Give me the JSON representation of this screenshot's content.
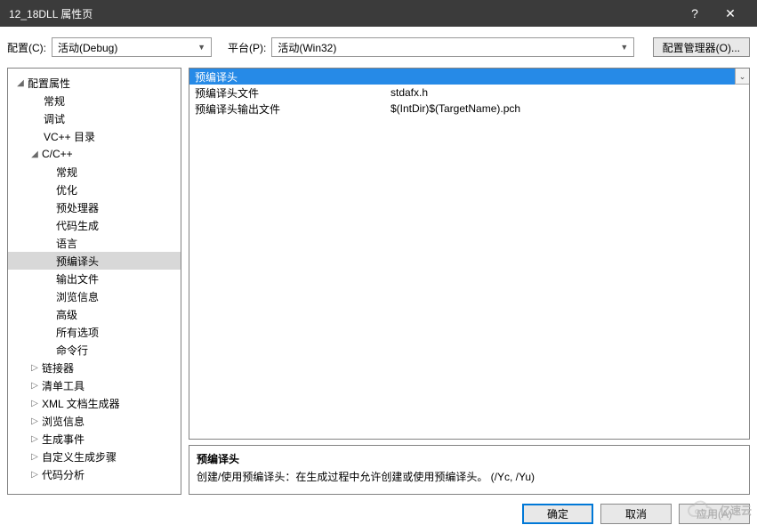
{
  "title": "12_18DLL 属性页",
  "help_glyph": "?",
  "close_glyph": "✕",
  "toolbar": {
    "config_label": "配置(C):",
    "config_value": "活动(Debug)",
    "platform_label": "平台(P):",
    "platform_value": "活动(Win32)",
    "manager_label": "配置管理器(O)..."
  },
  "tree": {
    "root": "配置属性",
    "items_lvl2_a": [
      "常规",
      "调试",
      "VC++ 目录"
    ],
    "cxx": "C/C++",
    "cxx_items": [
      "常规",
      "优化",
      "预处理器",
      "代码生成",
      "语言",
      "预编译头",
      "输出文件",
      "浏览信息",
      "高级",
      "所有选项",
      "命令行"
    ],
    "items_lvl2_b": [
      "链接器",
      "清单工具",
      "XML 文档生成器",
      "浏览信息",
      "生成事件",
      "自定义生成步骤",
      "代码分析"
    ]
  },
  "grid": {
    "rows": [
      {
        "name": "预编译头",
        "value": ""
      },
      {
        "name": "预编译头文件",
        "value": "stdafx.h"
      },
      {
        "name": "预编译头输出文件",
        "value": "$(IntDir)$(TargetName).pch"
      }
    ]
  },
  "desc": {
    "title": "预编译头",
    "body": "创建/使用预编译头：在生成过程中允许创建或使用预编译头。     (/Yc, /Yu)"
  },
  "buttons": {
    "ok": "确定",
    "cancel": "取消",
    "apply": "应用(A)"
  },
  "watermark": "亿速云"
}
